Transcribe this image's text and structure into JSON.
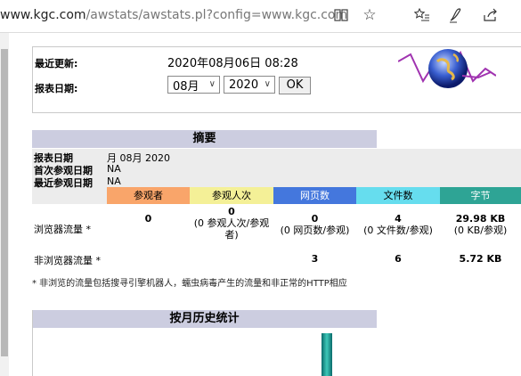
{
  "browser": {
    "url_main": "www.kgc.com",
    "url_rest": "/awstats/awstats.pl?config=www.kgc.com",
    "icons": [
      "reading-view-icon",
      "favorite-star-icon",
      "favorites-list-icon",
      "pen-icon",
      "share-icon"
    ]
  },
  "update": {
    "last_update_label": "最近更新:",
    "last_update_value": "2020年08月06日 08:28",
    "report_date_label": "报表日期:",
    "month_value": "08月",
    "year_value": "2020",
    "ok_label": "OK"
  },
  "summary": {
    "title": "摘要",
    "report_period_label": "报表日期",
    "report_period_value": "月 08月 2020",
    "first_visit_label": "首次参观日期",
    "first_visit_value": "NA",
    "last_visit_label": "最近参观日期",
    "last_visit_value": "NA",
    "columns": [
      {
        "label": "参观者",
        "color": "#f9a56a"
      },
      {
        "label": "参观人次",
        "color": "#f4f097"
      },
      {
        "label": "网页数",
        "color": "#4477dd"
      },
      {
        "label": "文件数",
        "color": "#66ddee"
      },
      {
        "label": "字节",
        "color": "#2ea495"
      }
    ],
    "browser_row": {
      "label": "浏览器流量 *",
      "visitors": "0",
      "visits": "0",
      "visits_sub": "(0 参观人次/参观者)",
      "pages": "0",
      "pages_sub": "(0 网页数/参观)",
      "files": "4",
      "files_sub": "(0 文件数/参观)",
      "bytes": "29.98 KB",
      "bytes_sub": "(0 KB/参观)"
    },
    "nonbrowser_row": {
      "label": "非浏览器流量 *",
      "pages": "3",
      "files": "6",
      "bytes": "5.72 KB"
    },
    "note": "* 非浏览的流量包括搜寻引擎机器人，蠕虫病毒产生的流量和非正常的HTTP相应"
  },
  "monthly": {
    "title": "按月历史统计"
  }
}
